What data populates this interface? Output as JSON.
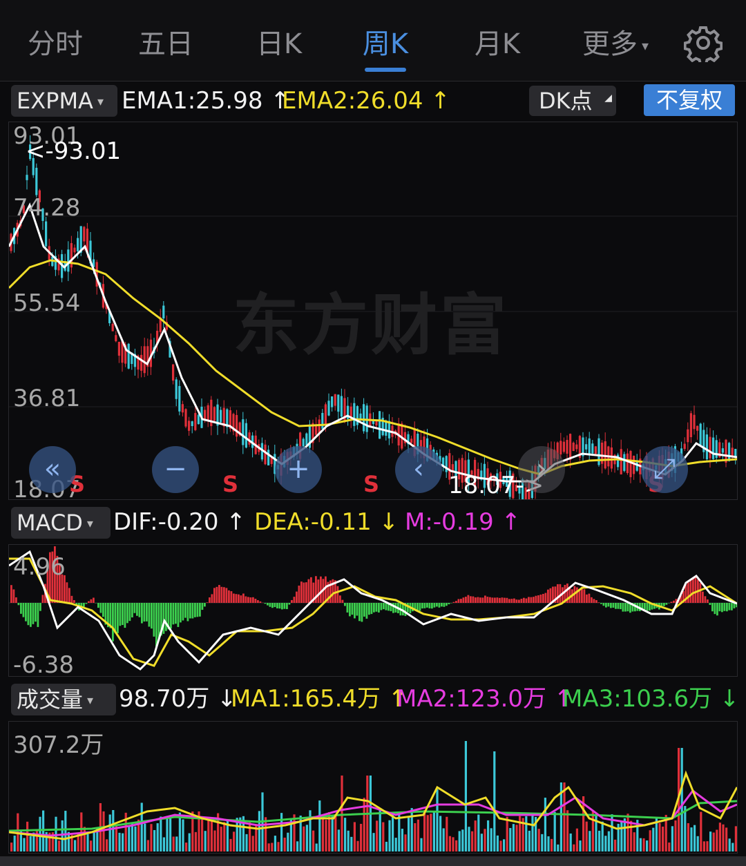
{
  "tabs": [
    {
      "label": "分时",
      "active": false
    },
    {
      "label": "五日",
      "active": false
    },
    {
      "label": "日K",
      "active": false
    },
    {
      "label": "周K",
      "active": true
    },
    {
      "label": "月K",
      "active": false
    },
    {
      "label": "更多",
      "active": false
    }
  ],
  "main_indicator": {
    "selector": "EXPMA",
    "ema1": "EMA1:25.98",
    "ema1_arrow": "↑",
    "ema2": "EMA2:26.04",
    "ema2_arrow": "↑",
    "dk_button": "DK点",
    "adjust_button": "不复权"
  },
  "price_axis": [
    "93.01",
    "74.28",
    "55.54",
    "36.81",
    "18.07"
  ],
  "price_markers": {
    "high": "<-93.01",
    "low": "18.07->"
  },
  "watermark": "东方财富",
  "controls": [
    {
      "icon": "double-left-icon",
      "glyph": "«"
    },
    {
      "icon": "zoom-out-icon",
      "glyph": "−"
    },
    {
      "icon": "zoom-in-icon",
      "glyph": "+"
    },
    {
      "icon": "chevron-left-icon",
      "glyph": "‹"
    },
    {
      "icon": "chevron-right-icon",
      "glyph": "›"
    },
    {
      "icon": "expand-icon",
      "glyph": "⤢"
    }
  ],
  "signal_label": "S",
  "macd": {
    "selector": "MACD",
    "dif": "DIF:-0.20",
    "dif_arrow": "↑",
    "dea": "DEA:-0.11",
    "dea_arrow": "↓",
    "m": "M:-0.19",
    "m_arrow": "↑",
    "axis": [
      "4.96",
      "-6.38"
    ]
  },
  "volume": {
    "selector": "成交量",
    "vol": "98.70万",
    "vol_arrow": "↓",
    "ma1": "MA1:165.4万",
    "ma1_arrow": "↑",
    "ma2": "MA2:123.0万",
    "ma2_arrow": "↑",
    "ma3": "MA3:103.6万",
    "ma3_arrow": "↓",
    "axis": [
      "307.2万"
    ]
  },
  "colors": {
    "up": "#e0303a",
    "down": "#3cc8d8",
    "ema1_line": "#ffffff",
    "ema2_line": "#f0dd2a",
    "accent": "#3a7fd5"
  }
}
